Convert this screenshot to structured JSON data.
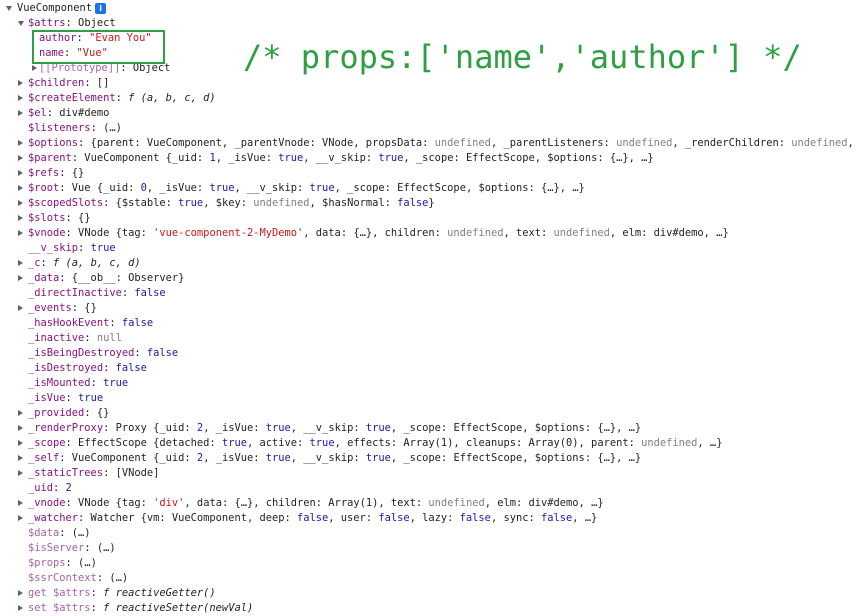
{
  "header": {
    "label": "VueComponent",
    "info_icon": "info-icon",
    "info_glyph": "i"
  },
  "annotation": "/* props:['name','author'] */",
  "rows": [
    {
      "id": "attrs",
      "indent": 1,
      "tri": "down",
      "segs": [
        {
          "t": "$attrs",
          "c": "k"
        },
        {
          "t": ": Object",
          "c": "v"
        }
      ]
    },
    {
      "id": "attrs-author",
      "indent": 2,
      "tri": "",
      "segs": [
        {
          "t": "author",
          "c": "k"
        },
        {
          "t": ": ",
          "c": "v"
        },
        {
          "t": "\"Evan You\"",
          "c": "s"
        }
      ]
    },
    {
      "id": "attrs-name",
      "indent": 2,
      "tri": "",
      "segs": [
        {
          "t": "name",
          "c": "k"
        },
        {
          "t": ": ",
          "c": "v"
        },
        {
          "t": "\"Vue\"",
          "c": "s"
        }
      ]
    },
    {
      "id": "attrs-prototype",
      "indent": 2,
      "tri": "right",
      "segs": [
        {
          "t": "[[Prototype]]",
          "c": "k dim"
        },
        {
          "t": ": Object",
          "c": "v"
        }
      ]
    },
    {
      "id": "children",
      "indent": 1,
      "tri": "right",
      "segs": [
        {
          "t": "$children",
          "c": "k"
        },
        {
          "t": ": []",
          "c": "v"
        }
      ]
    },
    {
      "id": "createElement",
      "indent": 1,
      "tri": "right",
      "segs": [
        {
          "t": "$createElement",
          "c": "k"
        },
        {
          "t": ": ",
          "c": "v"
        },
        {
          "t": "f (a, b, c, d)",
          "c": "f"
        }
      ]
    },
    {
      "id": "el",
      "indent": 1,
      "tri": "right",
      "segs": [
        {
          "t": "$el",
          "c": "k"
        },
        {
          "t": ": div#demo",
          "c": "v"
        }
      ]
    },
    {
      "id": "listeners",
      "indent": 1,
      "tri": "",
      "segs": [
        {
          "t": "$listeners",
          "c": "k"
        },
        {
          "t": ": (…)",
          "c": "v"
        }
      ]
    },
    {
      "id": "options",
      "indent": 1,
      "tri": "right",
      "segs": [
        {
          "t": "$options",
          "c": "k"
        },
        {
          "t": ": {parent: VueComponent, _parentVnode: VNode, propsData: ",
          "c": "v"
        },
        {
          "t": "undefined",
          "c": "u"
        },
        {
          "t": ", _parentListeners: ",
          "c": "v"
        },
        {
          "t": "undefined",
          "c": "u"
        },
        {
          "t": ", _renderChildren: ",
          "c": "v"
        },
        {
          "t": "undefined",
          "c": "u"
        },
        {
          "t": ", …",
          "c": "v"
        }
      ]
    },
    {
      "id": "parent",
      "indent": 1,
      "tri": "right",
      "segs": [
        {
          "t": "$parent",
          "c": "k"
        },
        {
          "t": ": VueComponent {_uid: ",
          "c": "v"
        },
        {
          "t": "1",
          "c": "n"
        },
        {
          "t": ", _isVue: ",
          "c": "v"
        },
        {
          "t": "true",
          "c": "n"
        },
        {
          "t": ", __v_skip: ",
          "c": "v"
        },
        {
          "t": "true",
          "c": "n"
        },
        {
          "t": ", _scope: EffectScope, $options: {…}, …}",
          "c": "v"
        }
      ]
    },
    {
      "id": "refs",
      "indent": 1,
      "tri": "right",
      "segs": [
        {
          "t": "$refs",
          "c": "k"
        },
        {
          "t": ": {}",
          "c": "v"
        }
      ]
    },
    {
      "id": "root",
      "indent": 1,
      "tri": "right",
      "segs": [
        {
          "t": "$root",
          "c": "k"
        },
        {
          "t": ": Vue {_uid: ",
          "c": "v"
        },
        {
          "t": "0",
          "c": "n"
        },
        {
          "t": ", _isVue: ",
          "c": "v"
        },
        {
          "t": "true",
          "c": "n"
        },
        {
          "t": ", __v_skip: ",
          "c": "v"
        },
        {
          "t": "true",
          "c": "n"
        },
        {
          "t": ", _scope: EffectScope, $options: {…}, …}",
          "c": "v"
        }
      ]
    },
    {
      "id": "scopedSlots",
      "indent": 1,
      "tri": "right",
      "segs": [
        {
          "t": "$scopedSlots",
          "c": "k"
        },
        {
          "t": ": {$stable: ",
          "c": "v"
        },
        {
          "t": "true",
          "c": "n"
        },
        {
          "t": ", $key: ",
          "c": "v"
        },
        {
          "t": "undefined",
          "c": "u"
        },
        {
          "t": ", $hasNormal: ",
          "c": "v"
        },
        {
          "t": "false",
          "c": "n"
        },
        {
          "t": "}",
          "c": "v"
        }
      ]
    },
    {
      "id": "slots",
      "indent": 1,
      "tri": "right",
      "segs": [
        {
          "t": "$slots",
          "c": "k"
        },
        {
          "t": ": {}",
          "c": "v"
        }
      ]
    },
    {
      "id": "vnode",
      "indent": 1,
      "tri": "right",
      "segs": [
        {
          "t": "$vnode",
          "c": "k"
        },
        {
          "t": ": VNode {tag: ",
          "c": "v"
        },
        {
          "t": "'vue-component-2-MyDemo'",
          "c": "s"
        },
        {
          "t": ", data: {…}, children: ",
          "c": "v"
        },
        {
          "t": "undefined",
          "c": "u"
        },
        {
          "t": ", text: ",
          "c": "v"
        },
        {
          "t": "undefined",
          "c": "u"
        },
        {
          "t": ", elm: div#demo, …}",
          "c": "v"
        }
      ]
    },
    {
      "id": "__v_skip",
      "indent": 1,
      "tri": "",
      "segs": [
        {
          "t": "__v_skip",
          "c": "k"
        },
        {
          "t": ": ",
          "c": "v"
        },
        {
          "t": "true",
          "c": "n"
        }
      ]
    },
    {
      "id": "_c",
      "indent": 1,
      "tri": "right",
      "segs": [
        {
          "t": "_c",
          "c": "k"
        },
        {
          "t": ": ",
          "c": "v"
        },
        {
          "t": "f (a, b, c, d)",
          "c": "f"
        }
      ]
    },
    {
      "id": "_data",
      "indent": 1,
      "tri": "right",
      "segs": [
        {
          "t": "_data",
          "c": "k"
        },
        {
          "t": ": {__ob__: Observer}",
          "c": "v"
        }
      ]
    },
    {
      "id": "_directInactive",
      "indent": 1,
      "tri": "",
      "segs": [
        {
          "t": "_directInactive",
          "c": "k"
        },
        {
          "t": ": ",
          "c": "v"
        },
        {
          "t": "false",
          "c": "n"
        }
      ]
    },
    {
      "id": "_events",
      "indent": 1,
      "tri": "right",
      "segs": [
        {
          "t": "_events",
          "c": "k"
        },
        {
          "t": ": {}",
          "c": "v"
        }
      ]
    },
    {
      "id": "_hasHookEvent",
      "indent": 1,
      "tri": "",
      "segs": [
        {
          "t": "_hasHookEvent",
          "c": "k"
        },
        {
          "t": ": ",
          "c": "v"
        },
        {
          "t": "false",
          "c": "n"
        }
      ]
    },
    {
      "id": "_inactive",
      "indent": 1,
      "tri": "",
      "segs": [
        {
          "t": "_inactive",
          "c": "k"
        },
        {
          "t": ": ",
          "c": "v"
        },
        {
          "t": "null",
          "c": "u"
        }
      ]
    },
    {
      "id": "_isBeingDestroyed",
      "indent": 1,
      "tri": "",
      "segs": [
        {
          "t": "_isBeingDestroyed",
          "c": "k"
        },
        {
          "t": ": ",
          "c": "v"
        },
        {
          "t": "false",
          "c": "n"
        }
      ]
    },
    {
      "id": "_isDestroyed",
      "indent": 1,
      "tri": "",
      "segs": [
        {
          "t": "_isDestroyed",
          "c": "k"
        },
        {
          "t": ": ",
          "c": "v"
        },
        {
          "t": "false",
          "c": "n"
        }
      ]
    },
    {
      "id": "_isMounted",
      "indent": 1,
      "tri": "",
      "segs": [
        {
          "t": "_isMounted",
          "c": "k"
        },
        {
          "t": ": ",
          "c": "v"
        },
        {
          "t": "true",
          "c": "n"
        }
      ]
    },
    {
      "id": "_isVue",
      "indent": 1,
      "tri": "",
      "segs": [
        {
          "t": "_isVue",
          "c": "k"
        },
        {
          "t": ": ",
          "c": "v"
        },
        {
          "t": "true",
          "c": "n"
        }
      ]
    },
    {
      "id": "_provided",
      "indent": 1,
      "tri": "right",
      "segs": [
        {
          "t": "_provided",
          "c": "k"
        },
        {
          "t": ": {}",
          "c": "v"
        }
      ]
    },
    {
      "id": "_renderProxy",
      "indent": 1,
      "tri": "right",
      "segs": [
        {
          "t": "_renderProxy",
          "c": "k"
        },
        {
          "t": ": Proxy {_uid: ",
          "c": "v"
        },
        {
          "t": "2",
          "c": "n"
        },
        {
          "t": ", _isVue: ",
          "c": "v"
        },
        {
          "t": "true",
          "c": "n"
        },
        {
          "t": ", __v_skip: ",
          "c": "v"
        },
        {
          "t": "true",
          "c": "n"
        },
        {
          "t": ", _scope: EffectScope, $options: {…}, …}",
          "c": "v"
        }
      ]
    },
    {
      "id": "_scope",
      "indent": 1,
      "tri": "right",
      "segs": [
        {
          "t": "_scope",
          "c": "k"
        },
        {
          "t": ": EffectScope {detached: ",
          "c": "v"
        },
        {
          "t": "true",
          "c": "n"
        },
        {
          "t": ", active: ",
          "c": "v"
        },
        {
          "t": "true",
          "c": "n"
        },
        {
          "t": ", effects: Array(1), cleanups: Array(0), parent: ",
          "c": "v"
        },
        {
          "t": "undefined",
          "c": "u"
        },
        {
          "t": ", …}",
          "c": "v"
        }
      ]
    },
    {
      "id": "_self",
      "indent": 1,
      "tri": "right",
      "segs": [
        {
          "t": "_self",
          "c": "k"
        },
        {
          "t": ": VueComponent {_uid: ",
          "c": "v"
        },
        {
          "t": "2",
          "c": "n"
        },
        {
          "t": ", _isVue: ",
          "c": "v"
        },
        {
          "t": "true",
          "c": "n"
        },
        {
          "t": ", __v_skip: ",
          "c": "v"
        },
        {
          "t": "true",
          "c": "n"
        },
        {
          "t": ", _scope: EffectScope, $options: {…}, …}",
          "c": "v"
        }
      ]
    },
    {
      "id": "_staticTrees",
      "indent": 1,
      "tri": "right",
      "segs": [
        {
          "t": "_staticTrees",
          "c": "k"
        },
        {
          "t": ": [VNode]",
          "c": "v"
        }
      ]
    },
    {
      "id": "_uid",
      "indent": 1,
      "tri": "",
      "segs": [
        {
          "t": "_uid",
          "c": "k"
        },
        {
          "t": ": ",
          "c": "v"
        },
        {
          "t": "2",
          "c": "n"
        }
      ]
    },
    {
      "id": "_vnode",
      "indent": 1,
      "tri": "right",
      "segs": [
        {
          "t": "_vnode",
          "c": "k"
        },
        {
          "t": ": VNode {tag: ",
          "c": "v"
        },
        {
          "t": "'div'",
          "c": "s"
        },
        {
          "t": ", data: {…}, children: Array(1), text: ",
          "c": "v"
        },
        {
          "t": "undefined",
          "c": "u"
        },
        {
          "t": ", elm: div#demo, …}",
          "c": "v"
        }
      ]
    },
    {
      "id": "_watcher",
      "indent": 1,
      "tri": "right",
      "segs": [
        {
          "t": "_watcher",
          "c": "k"
        },
        {
          "t": ": Watcher {vm: VueComponent, deep: ",
          "c": "v"
        },
        {
          "t": "false",
          "c": "n"
        },
        {
          "t": ", user: ",
          "c": "v"
        },
        {
          "t": "false",
          "c": "n"
        },
        {
          "t": ", lazy: ",
          "c": "v"
        },
        {
          "t": "false",
          "c": "n"
        },
        {
          "t": ", sync: ",
          "c": "v"
        },
        {
          "t": "false",
          "c": "n"
        },
        {
          "t": ", …}",
          "c": "v"
        }
      ]
    },
    {
      "id": "data-getter",
      "indent": 1,
      "tri": "",
      "segs": [
        {
          "t": "$data",
          "c": "k dim"
        },
        {
          "t": ": (…)",
          "c": "v"
        }
      ]
    },
    {
      "id": "isServer",
      "indent": 1,
      "tri": "",
      "segs": [
        {
          "t": "$isServer",
          "c": "k dim"
        },
        {
          "t": ": (…)",
          "c": "v"
        }
      ]
    },
    {
      "id": "props",
      "indent": 1,
      "tri": "",
      "segs": [
        {
          "t": "$props",
          "c": "k dim"
        },
        {
          "t": ": (…)",
          "c": "v"
        }
      ]
    },
    {
      "id": "ssrContext",
      "indent": 1,
      "tri": "",
      "segs": [
        {
          "t": "$ssrContext",
          "c": "k dim"
        },
        {
          "t": ": (…)",
          "c": "v"
        }
      ]
    },
    {
      "id": "get-attrs",
      "indent": 1,
      "tri": "right",
      "segs": [
        {
          "t": "get $attrs",
          "c": "k dim"
        },
        {
          "t": ": ",
          "c": "v"
        },
        {
          "t": "f reactiveGetter()",
          "c": "f"
        }
      ]
    },
    {
      "id": "set-attrs",
      "indent": 1,
      "tri": "right",
      "segs": [
        {
          "t": "set $attrs",
          "c": "k dim"
        },
        {
          "t": ": ",
          "c": "v"
        },
        {
          "t": "f reactiveSetter(newVal)",
          "c": "f"
        }
      ]
    }
  ]
}
